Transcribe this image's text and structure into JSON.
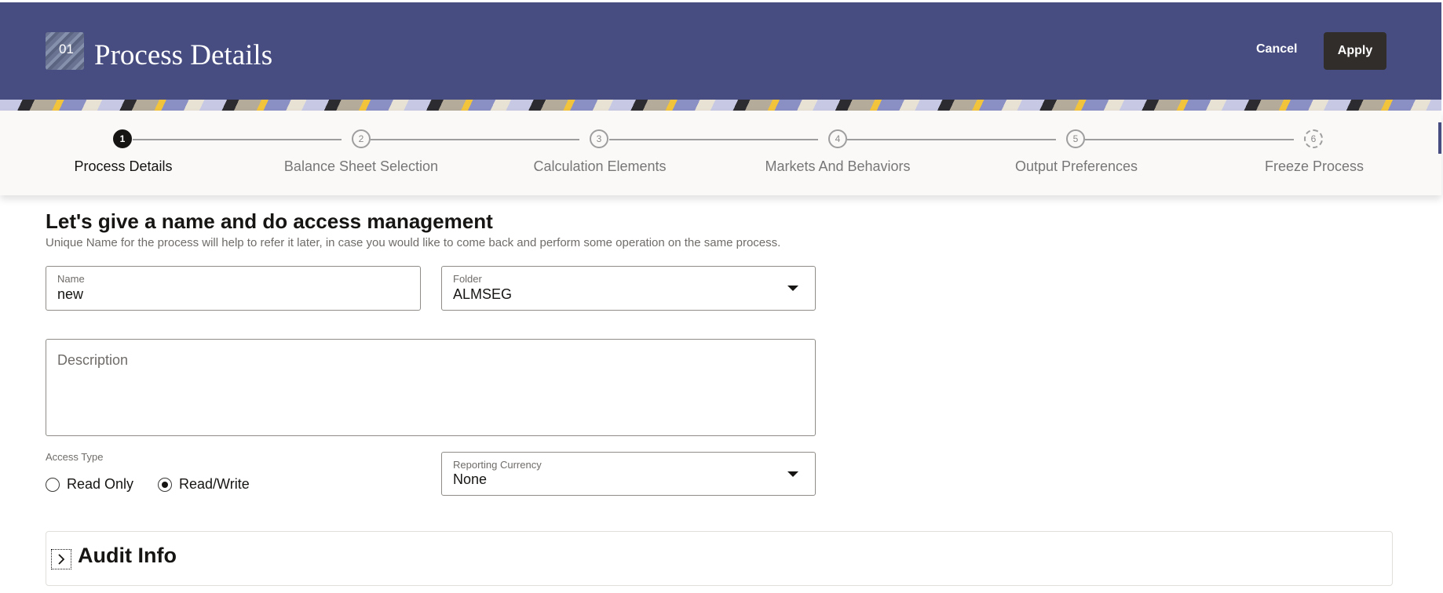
{
  "header": {
    "step_number": "01",
    "title": "Process Details",
    "cancel_label": "Cancel",
    "apply_label": "Apply"
  },
  "train": {
    "steps": [
      {
        "number": "1",
        "label": "Process Details",
        "state": "active"
      },
      {
        "number": "2",
        "label": "Balance Sheet Selection",
        "state": "pending"
      },
      {
        "number": "3",
        "label": "Calculation Elements",
        "state": "pending"
      },
      {
        "number": "4",
        "label": "Markets And Behaviors",
        "state": "pending"
      },
      {
        "number": "5",
        "label": "Output Preferences",
        "state": "pending"
      },
      {
        "number": "6",
        "label": "Freeze Process",
        "state": "pending-dashed"
      }
    ]
  },
  "main": {
    "heading": "Let's give a name and do access management",
    "subheading": "Unique Name for the process will help to refer it later, in case you would like to come back and perform some operation on the same process.",
    "name_field": {
      "label": "Name",
      "value": "new"
    },
    "folder_field": {
      "label": "Folder",
      "value": "ALMSEG"
    },
    "description_field": {
      "placeholder": "Description",
      "value": ""
    },
    "access_type": {
      "label": "Access Type",
      "options": [
        {
          "label": "Read Only",
          "checked": false
        },
        {
          "label": "Read/Write",
          "checked": true
        }
      ]
    },
    "reporting_currency": {
      "label": "Reporting Currency",
      "value": "None"
    },
    "audit_section": {
      "title": "Audit Info",
      "expanded": false
    }
  },
  "colors": {
    "header_bg": "#474d80",
    "apply_bg": "#312d2a",
    "active_step": "#161513"
  }
}
